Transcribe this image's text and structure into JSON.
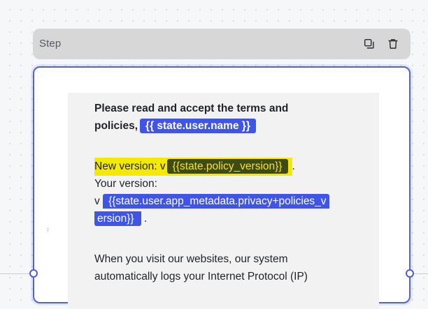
{
  "step_header": {
    "title": "Step",
    "copy_icon": "copy-icon",
    "delete_icon": "trash-icon"
  },
  "editor": {
    "heading_part1": "Please read and accept the terms and",
    "heading_part2": "policies,",
    "user_name_var": "{{ state.user.name }}",
    "new_version_label": "New version: v",
    "policy_version_var": "{{state.policy_version}}",
    "new_version_end": ".",
    "your_version_label": "Your version:",
    "your_version_prefix": "v",
    "metadata_var_line1": "{{state.user.app_metadata.privacy+policies_v",
    "metadata_var_line2": "ersion}}",
    "your_version_end": ".",
    "body_line1": "When you visit our websites, our system",
    "body_line2": "automatically logs your Internet Protocol (IP)"
  },
  "colors": {
    "card_border": "#5462d4",
    "variable_chip": "#3e55e5",
    "highlight": "#f5e900",
    "highlight_chip": "#404a14"
  }
}
